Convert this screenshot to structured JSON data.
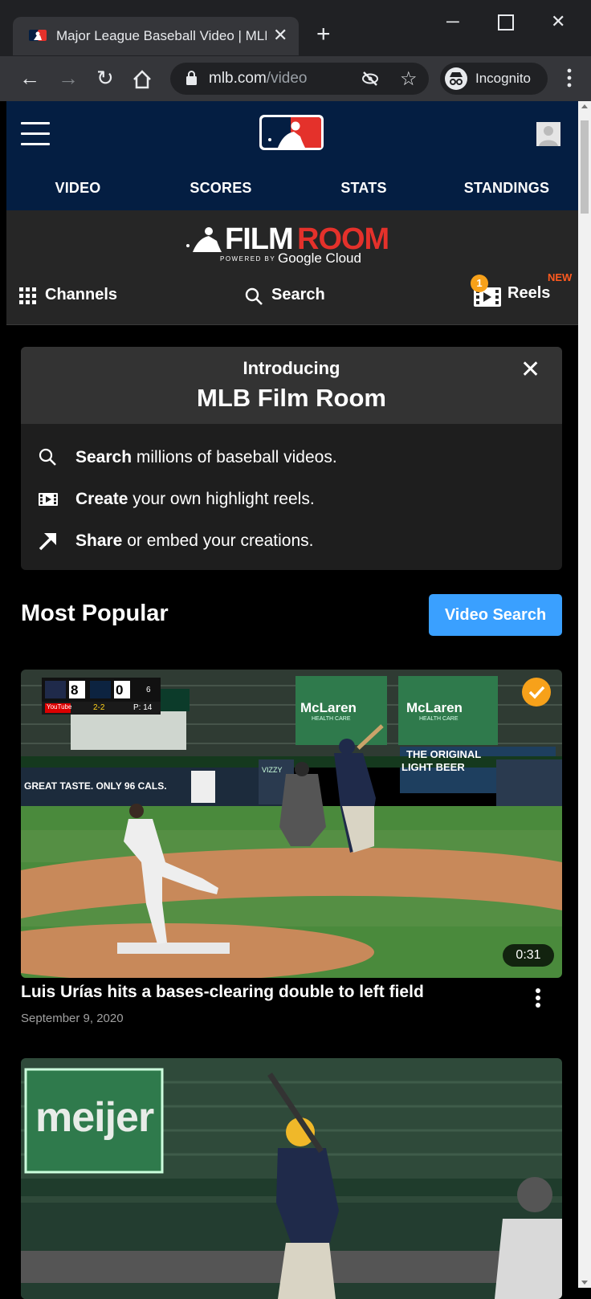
{
  "browser": {
    "tab_title": "Major League Baseball Video | MLB",
    "new_tab": "+",
    "url_host": "mlb.com",
    "url_path": "/video",
    "incognito_label": "Incognito",
    "window_controls": [
      "minimize-icon",
      "maximize-icon",
      "close-icon"
    ]
  },
  "header": {
    "nav": [
      "VIDEO",
      "SCORES",
      "STATS",
      "STANDINGS"
    ]
  },
  "filmroom": {
    "logo_film": "FILM",
    "logo_room": "ROOM",
    "powered_by": "POWERED BY",
    "google_cloud": "Google Cloud",
    "channels_label": "Channels",
    "search_label": "Search",
    "reels_label": "Reels",
    "reels_badge": "NEW",
    "reels_count": "1"
  },
  "intro": {
    "small_title": "Introducing",
    "big_title": "MLB Film Room",
    "features": [
      {
        "bold": "Search",
        "rest": " millions of baseball videos.",
        "icon": "search-icon"
      },
      {
        "bold": "Create",
        "rest": " your own highlight reels.",
        "icon": "film-icon"
      },
      {
        "bold": "Share",
        "rest": " or embed your creations.",
        "icon": "share-arrow-icon"
      }
    ]
  },
  "popular": {
    "title": "Most Popular",
    "video_search_label": "Video Search",
    "videos": [
      {
        "title": "Luis Urías hits a bases-clearing double to left field",
        "date": "September 9, 2020",
        "duration": "0:31",
        "scorebug": {
          "away_runs": "8",
          "home_runs": "0",
          "inning": "6",
          "count": "2-2",
          "pitches": "P: 14",
          "network": "YouTube"
        },
        "signs": [
          "McLaren",
          "HEALTH CARE",
          "THE ORIGINAL",
          "LIGHT BEER",
          "GREAT TASTE. ONLY 96 CALS.",
          "VIZZY"
        ]
      },
      {
        "sign": "meijer"
      }
    ]
  },
  "colors": {
    "mlb_navy": "#041e42",
    "accent_blue": "#3aa0ff",
    "accent_orange": "#f7a11a",
    "room_red": "#e4312b"
  }
}
